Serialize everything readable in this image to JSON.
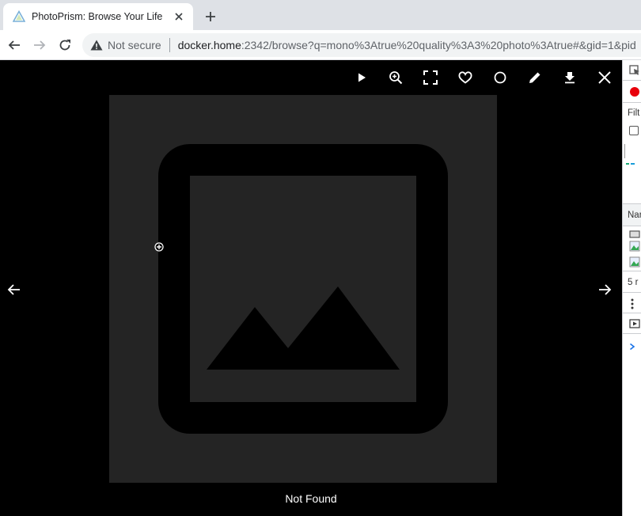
{
  "browser": {
    "tab_title": "PhotoPrism: Browse Your Life",
    "security_label": "Not secure",
    "url_host": "docker.home",
    "url_rest": ":2342/browse?q=mono%3Atrue%20quality%3A3%20photo%3Atrue#&gid=1&pid"
  },
  "viewer": {
    "caption": "Not Found",
    "toolbar_icons": [
      "play-icon",
      "zoom-in-icon",
      "fullscreen-icon",
      "heart-icon",
      "circle-select-icon",
      "edit-icon",
      "download-icon",
      "close-icon"
    ]
  },
  "devtools": {
    "filter_label": "Filt",
    "name_header": "Nar",
    "count_text": "5 r"
  },
  "colors": {
    "viewer_bg": "#000000",
    "image_placeholder_bg": "#242424",
    "record_red": "#e8000b",
    "link_blue": "#1a73e8"
  }
}
